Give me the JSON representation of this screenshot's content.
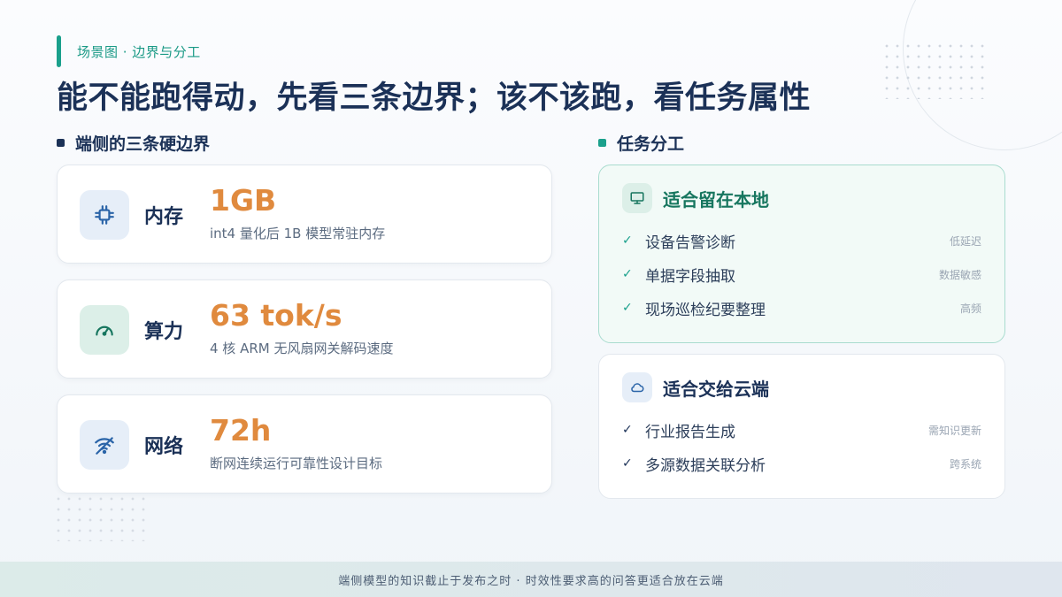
{
  "eyebrow": "场景图 · 边界与分工",
  "title": "能不能跑得动，先看三条边界；该不该跑，看任务属性",
  "left_section": {
    "heading": "端侧的三条硬边界",
    "metrics": [
      {
        "icon": "chip-icon",
        "name": "内存",
        "value": "1GB",
        "desc": "int4 量化后 1B 模型常驻内存"
      },
      {
        "icon": "gauge-icon",
        "name": "算力",
        "value": "63 tok/s",
        "desc": "4 核 ARM 无风扇网关解码速度"
      },
      {
        "icon": "wifi-off-icon",
        "name": "网络",
        "value": "72h",
        "desc": "断网连续运行可靠性设计目标"
      }
    ]
  },
  "right_section": {
    "heading": "任务分工",
    "local": {
      "icon": "monitor-icon",
      "title": "适合留在本地",
      "items": [
        {
          "label": "设备告警诊断",
          "tag": "低延迟"
        },
        {
          "label": "单据字段抽取",
          "tag": "数据敏感"
        },
        {
          "label": "现场巡检纪要整理",
          "tag": "高频"
        }
      ]
    },
    "cloud": {
      "icon": "cloud-icon",
      "title": "适合交给云端",
      "items": [
        {
          "label": "行业报告生成",
          "tag": "需知识更新"
        },
        {
          "label": "多源数据关联分析",
          "tag": "跨系统"
        }
      ]
    }
  },
  "footer": "端侧模型的知识截止于发布之时 · 时效性要求高的问答更适合放在云端",
  "colors": {
    "accent_teal": "#1aa08c",
    "accent_orange": "#e08a3e",
    "navy": "#1b3157"
  }
}
